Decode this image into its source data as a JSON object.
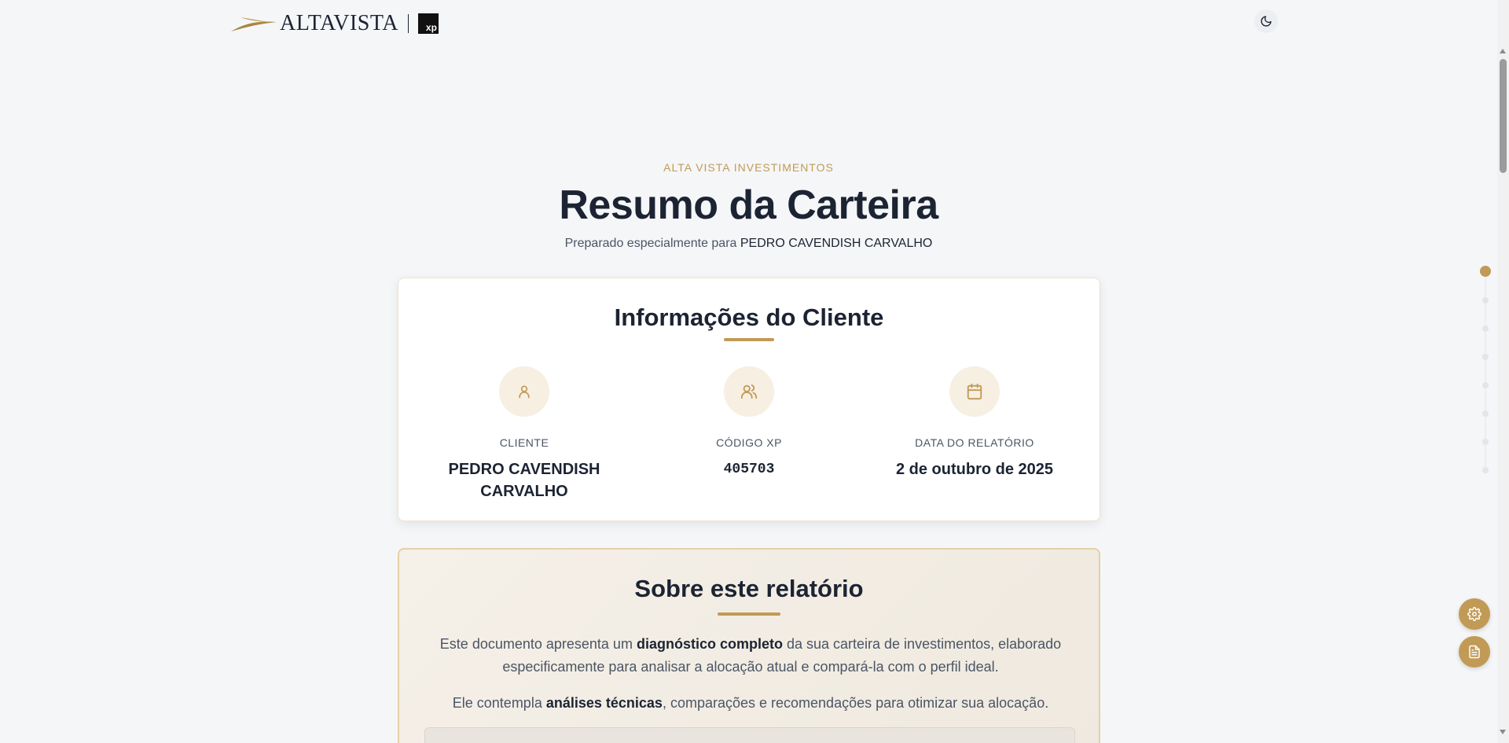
{
  "header": {
    "brand": "ALTAVISTA",
    "partner": "xp",
    "theme_toggle_icon": "moon-icon"
  },
  "hero": {
    "eyebrow": "ALTA VISTA INVESTIMENTOS",
    "title": "Resumo da Carteira",
    "subtitle_prefix": "Preparado especialmente para ",
    "client_name": "PEDRO CAVENDISH CARVALHO"
  },
  "client_info": {
    "title": "Informações do Cliente",
    "items": [
      {
        "icon": "user-icon",
        "label": "CLIENTE",
        "value": "PEDRO CAVENDISH CARVALHO"
      },
      {
        "icon": "users-icon",
        "label": "CÓDIGO XP",
        "value": "405703"
      },
      {
        "icon": "calendar-icon",
        "label": "DATA DO RELATÓRIO",
        "value": "2 de outubro de 2025"
      }
    ]
  },
  "about": {
    "title": "Sobre este relatório",
    "p1_a": "Este documento apresenta um ",
    "p1_b": "diagnóstico completo",
    "p1_c": " da sua carteira de investimentos, elaborado especificamente para analisar a alocação atual e compará-la com o perfil ideal.",
    "p2_a": "Ele contempla ",
    "p2_b": "análises técnicas",
    "p2_c": ", comparações e recomendações para otimizar sua alocação."
  },
  "floating": {
    "settings_icon": "gear-icon",
    "report_icon": "document-icon"
  },
  "colors": {
    "accent": "#c19a55",
    "text": "#1c2433",
    "background": "#f5f6f8"
  }
}
